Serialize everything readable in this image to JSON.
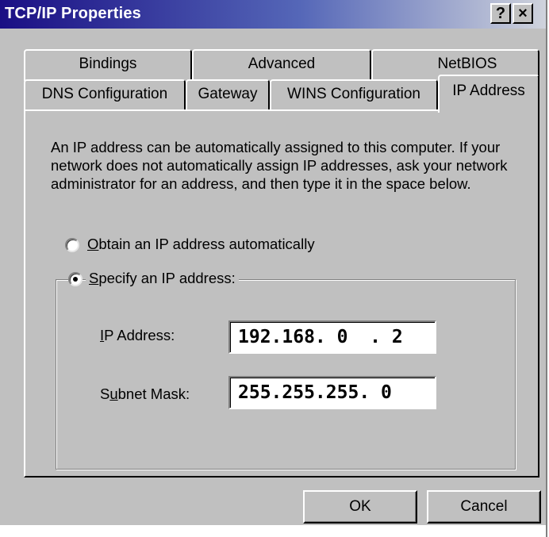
{
  "window": {
    "title": "TCP/IP Properties",
    "help_glyph": "?",
    "close_glyph": "×"
  },
  "tabs": {
    "back_row": [
      "Bindings",
      "Advanced",
      "NetBIOS"
    ],
    "front_row": [
      "DNS Configuration",
      "Gateway",
      "WINS Configuration",
      "IP Address"
    ],
    "active": "IP Address"
  },
  "panel": {
    "description": "An IP address can be automatically assigned to this computer. If your network does not automatically assign IP addresses, ask your network administrator for an address, and then type it in the space below.",
    "option_auto": {
      "mnemonic": "O",
      "rest": "btain an IP address automatically",
      "selected": false
    },
    "option_specify": {
      "mnemonic": "S",
      "rest": "pecify an IP address:",
      "selected": true
    },
    "ip_address": {
      "pre": "",
      "mnemonic": "I",
      "post": "P Address:",
      "value": "192.168. 0  . 2"
    },
    "subnet_mask": {
      "pre": "S",
      "mnemonic": "u",
      "post": "bnet Mask:",
      "value": "255.255.255. 0"
    }
  },
  "buttons": {
    "ok": "OK",
    "cancel": "Cancel"
  },
  "colors": {
    "face": "#c0c0c0",
    "title_start": "#1a0f84",
    "title_end": "#cfd3dc"
  }
}
